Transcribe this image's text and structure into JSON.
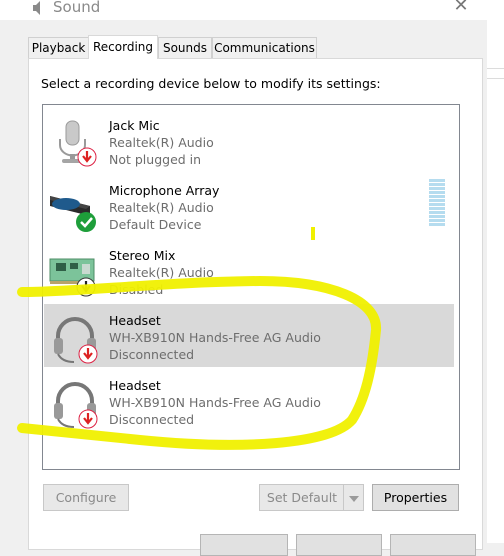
{
  "window": {
    "title": "Sound",
    "close_glyph": "✕"
  },
  "tabs": [
    {
      "label": "Playback"
    },
    {
      "label": "Recording"
    },
    {
      "label": "Sounds"
    },
    {
      "label": "Communications"
    }
  ],
  "instructions": "Select a recording device below to modify its settings:",
  "devices": [
    {
      "name": "Jack Mic",
      "driver": "Realtek(R) Audio",
      "status": "Not plugged in",
      "icon": "microphone-icon",
      "badge": "red-down-arrow"
    },
    {
      "name": "Microphone Array",
      "driver": "Realtek(R) Audio",
      "status": "Default Device",
      "icon": "microphone-array-icon",
      "badge": "green-check"
    },
    {
      "name": "Stereo Mix",
      "driver": "Realtek(R) Audio",
      "status": "Disabled",
      "icon": "sound-card-icon",
      "badge": "black-down-arrow"
    },
    {
      "name": "Headset",
      "driver": "WH-XB910N Hands-Free AG Audio",
      "status": "Disconnected",
      "icon": "headset-icon",
      "badge": "red-down-arrow",
      "selected": true
    },
    {
      "name": "Headset",
      "driver": "WH-XB910N Hands-Free AG Audio",
      "status": "Disconnected",
      "icon": "headset-icon",
      "badge": "red-down-arrow"
    }
  ],
  "buttons": {
    "configure": "Configure",
    "set_default": "Set Default",
    "properties": "Properties"
  },
  "colors": {
    "annotation": "#f0f000",
    "selection": "#d9d9d9",
    "level_meter": "#b5dcef"
  }
}
